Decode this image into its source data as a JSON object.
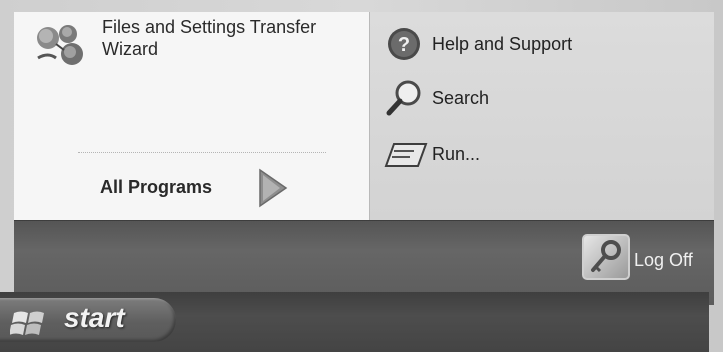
{
  "left_panel": {
    "pinned": [
      {
        "label_line1": "Files and Settings Transfer",
        "label_line2": "Wizard",
        "icon": "files-settings-transfer-icon"
      }
    ],
    "all_programs_label": "All Programs"
  },
  "right_panel": {
    "items": [
      {
        "label": "Help and Support",
        "icon": "help-icon"
      },
      {
        "label": "Search",
        "icon": "search-icon"
      },
      {
        "label": "Run...",
        "icon": "run-icon"
      }
    ]
  },
  "footer": {
    "log_off_label": "Log Off"
  },
  "taskbar": {
    "start_label": "start"
  }
}
